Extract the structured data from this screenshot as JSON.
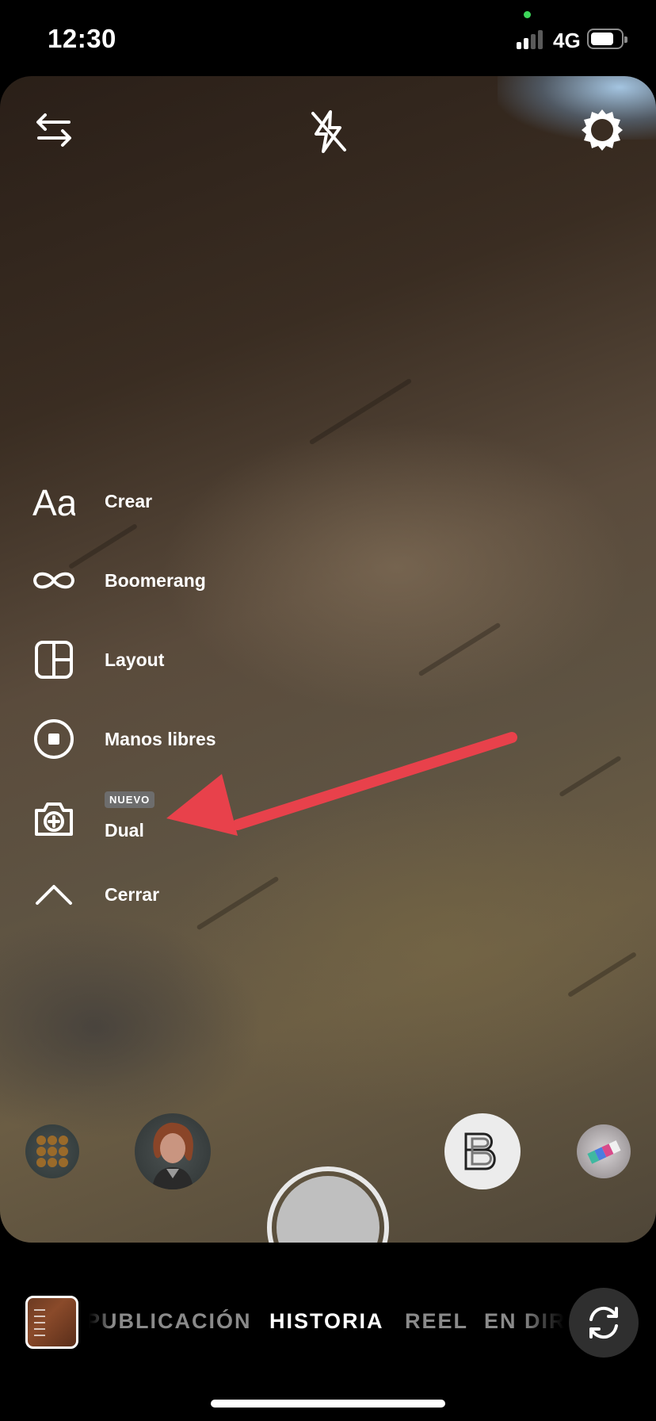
{
  "status_bar": {
    "time": "12:30",
    "network": "4G",
    "battery_level": 0.78
  },
  "camera": {
    "top_icons": [
      "switch-arrows-icon",
      "flash-off-icon",
      "settings-gear-icon"
    ]
  },
  "side_menu": {
    "items": [
      {
        "label": "Crear",
        "icon": "text-aa-icon"
      },
      {
        "label": "Boomerang",
        "icon": "infinity-icon"
      },
      {
        "label": "Layout",
        "icon": "layout-grid-icon"
      },
      {
        "label": "Manos libres",
        "icon": "hands-free-stop-icon"
      },
      {
        "label": "Dual",
        "badge": "NUEVO",
        "icon": "dual-camera-icon"
      },
      {
        "label": "Cerrar",
        "icon": "chevron-up-icon"
      }
    ]
  },
  "annotation": {
    "color": "#e8414b"
  },
  "effects": [
    "grid-effect",
    "avatar-effect",
    "shutter",
    "b-logo-effect",
    "prism-effect"
  ],
  "mode_bar": {
    "tabs": [
      "PUBLICACIÓN",
      "HISTORIA",
      "REEL",
      "EN DIRECTO"
    ],
    "active_tab": "HISTORIA"
  }
}
